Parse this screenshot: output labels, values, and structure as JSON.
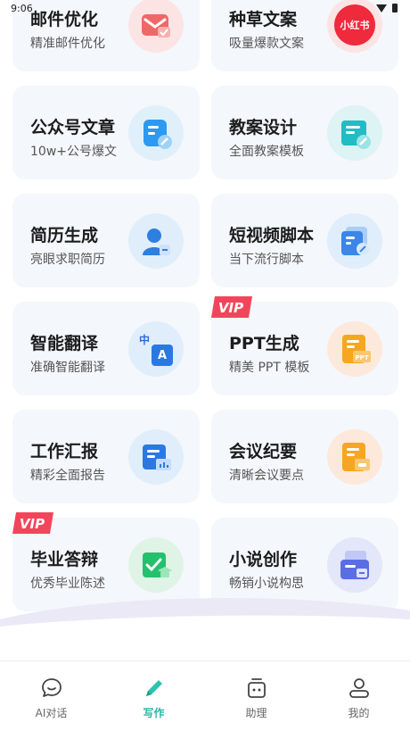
{
  "status": {
    "time": "9:06"
  },
  "cards": [
    {
      "title": "邮件优化",
      "subtitle": "精准邮件优化",
      "icon": "mail-icon",
      "vip": false,
      "circle": "#fde4e4"
    },
    {
      "title": "种草文案",
      "subtitle": "吸量爆款文案",
      "icon": "xiaohongshu-icon",
      "vip": false,
      "circle": "#fde4e4",
      "icon_text": "小红书"
    },
    {
      "title": "公众号文章",
      "subtitle": "10w+公号爆文",
      "icon": "article-icon",
      "vip": false,
      "circle": "#e0f0fb"
    },
    {
      "title": "教案设计",
      "subtitle": "全面教案模板",
      "icon": "lesson-plan-icon",
      "vip": false,
      "circle": "#ddf3f4"
    },
    {
      "title": "简历生成",
      "subtitle": "亮眼求职简历",
      "icon": "resume-icon",
      "vip": false,
      "circle": "#e0eefb"
    },
    {
      "title": "短视频脚本",
      "subtitle": "当下流行脚本",
      "icon": "video-script-icon",
      "vip": false,
      "circle": "#e0eefb"
    },
    {
      "title": "智能翻译",
      "subtitle": "准确智能翻译",
      "icon": "translate-icon",
      "vip": false,
      "circle": "#e0eefb",
      "icon_text_a": "中",
      "icon_text_b": "A"
    },
    {
      "title": "PPT生成",
      "subtitle": "精美 PPT 模板",
      "icon": "ppt-icon",
      "vip": true,
      "circle": "#fde9dc",
      "icon_text": "PPT"
    },
    {
      "title": "工作汇报",
      "subtitle": "精彩全面报告",
      "icon": "report-icon",
      "vip": false,
      "circle": "#e0eefb"
    },
    {
      "title": "会议纪要",
      "subtitle": "清晰会议要点",
      "icon": "meeting-notes-icon",
      "vip": false,
      "circle": "#fde9dc"
    },
    {
      "title": "毕业答辩",
      "subtitle": "优秀毕业陈述",
      "icon": "graduation-icon",
      "vip": true,
      "circle": "#dff4e6"
    },
    {
      "title": "小说创作",
      "subtitle": "畅销小说构思",
      "icon": "novel-icon",
      "vip": false,
      "circle": "#e4e6fa"
    }
  ],
  "vip_label": "VIP",
  "tabs": [
    {
      "label": "AI对话",
      "icon": "chat-icon",
      "active": false
    },
    {
      "label": "写作",
      "icon": "pen-icon",
      "active": true
    },
    {
      "label": "助理",
      "icon": "assistant-icon",
      "active": false
    },
    {
      "label": "我的",
      "icon": "profile-icon",
      "active": false
    }
  ]
}
